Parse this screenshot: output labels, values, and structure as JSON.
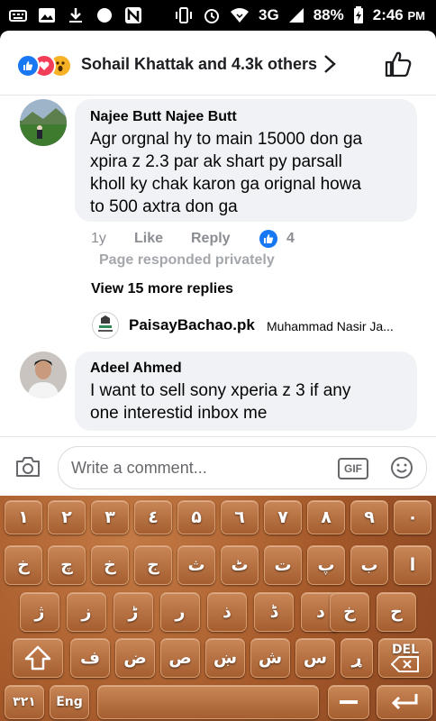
{
  "status_bar": {
    "network": "3G",
    "battery": "88%",
    "time": "2:46",
    "ampm": "PM"
  },
  "reactions": {
    "summary_text": "Sohail Khattak and 4.3k others",
    "icons": [
      "like-icon",
      "love-icon",
      "wow-icon"
    ]
  },
  "comments": [
    {
      "author": "Najee Butt Najee Butt",
      "text_lines": [
        "Agr orgnal hy to main 15000 don ga",
        "xpira z 2.3 par ak shart py parsall",
        "kholl ky chak karon ga orignal howa",
        "to 500 axtra don ga"
      ],
      "age": "1y",
      "like_label": "Like",
      "reply_label": "Reply",
      "like_count": "4",
      "page_note": "Page responded privately",
      "view_more": "View 15 more replies",
      "reply_preview": {
        "author": "PaisayBachao.pk",
        "text": "Muhammad Nasir Ja..."
      }
    },
    {
      "author": "Adeel Ahmed",
      "text_lines": [
        "I want to sell sony xperia z 3 if any",
        "one interestid inbox me"
      ]
    }
  ],
  "composer": {
    "placeholder": "Write a comment...",
    "gif_label": "GIF"
  },
  "keyboard": {
    "row1": [
      "۱",
      "۲",
      "۳",
      "٤",
      "۵",
      "٦",
      "۷",
      "۸",
      "۹",
      "۰"
    ],
    "row2": [
      "خ",
      "چ",
      "خ",
      "ج",
      "ث",
      "ٹ",
      "ت",
      "پ",
      "ب",
      "ا"
    ],
    "row3": [
      "ژ",
      "ز",
      "ڑ",
      "ر",
      "ذ",
      "ڈ",
      "د",
      "خ",
      "ح"
    ],
    "row4": [
      "ف",
      "ض",
      "ص",
      "ښ",
      "ش",
      "س",
      "ړ"
    ],
    "del_label": "DEL",
    "numkey_label": "۳۲۱",
    "eng_label": "Eng"
  },
  "colors": {
    "like_blue": "#1877f2",
    "bubble_grey": "#f0f2f5",
    "keyboard_leather": "#a5592a"
  }
}
